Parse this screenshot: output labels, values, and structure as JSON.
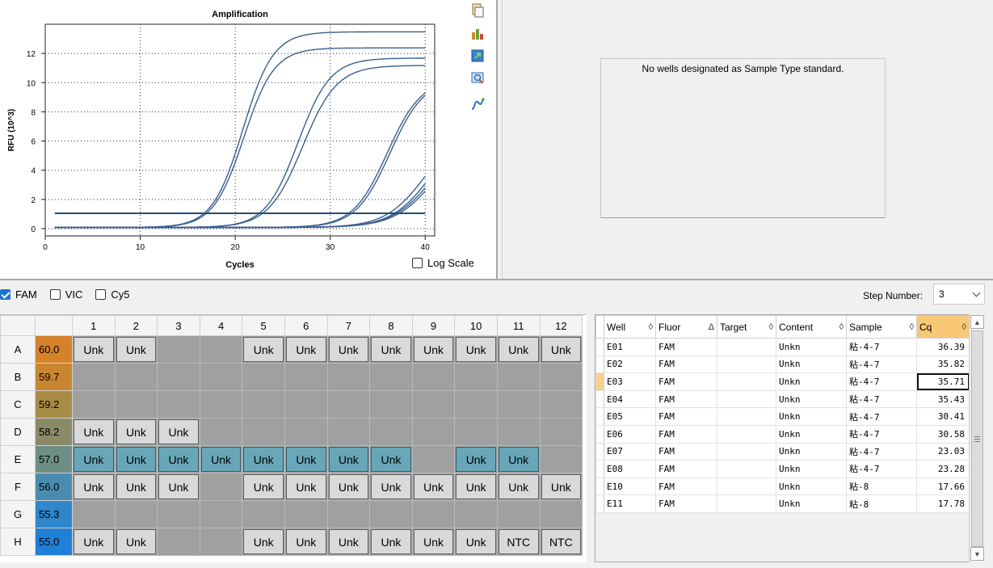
{
  "chart": {
    "title": "Amplification",
    "xlabel": "Cycles",
    "ylabel": "RFU (10^3)",
    "log_scale_label": "Log Scale"
  },
  "chart_data": {
    "type": "line",
    "title": "Amplification",
    "xlabel": "Cycles",
    "ylabel": "RFU (10^3)",
    "xlim": [
      0,
      41
    ],
    "ylim": [
      -0.5,
      14
    ],
    "xticks": [
      "0",
      "10",
      "20",
      "30",
      "40"
    ],
    "yticks": [
      "0",
      "2",
      "4",
      "6",
      "8",
      "10",
      "12"
    ],
    "grid": true,
    "threshold": 1.05,
    "curve_color": "#3a5f8f",
    "threshold_color": "#1f4e79",
    "curves": [
      {
        "well": "E07",
        "midpoint": 20.8,
        "max": 13.4,
        "slope": 1.6
      },
      {
        "well": "E08",
        "midpoint": 20.9,
        "max": 12.3,
        "slope": 1.6
      },
      {
        "well": "E05",
        "midpoint": 26.6,
        "max": 11.6,
        "slope": 1.7
      },
      {
        "well": "E06",
        "midpoint": 27.1,
        "max": 11.1,
        "slope": 1.8
      },
      {
        "well": "E10",
        "midpoint": 36.0,
        "max": 10.2,
        "slope": 1.8
      },
      {
        "well": "E11",
        "midpoint": 36.3,
        "max": 10.2,
        "slope": 1.8
      },
      {
        "well": "E01",
        "midpoint": 40.0,
        "max": 7.0,
        "slope": 2.1
      },
      {
        "well": "E02",
        "midpoint": 40.6,
        "max": 7.0,
        "slope": 2.1
      },
      {
        "well": "E03",
        "midpoint": 41.0,
        "max": 7.0,
        "slope": 2.2
      },
      {
        "well": "E04",
        "midpoint": 41.3,
        "max": 7.0,
        "slope": 2.2
      }
    ]
  },
  "std_panel": {
    "message": "No wells designated as Sample Type standard."
  },
  "fluors": [
    {
      "label": "FAM",
      "checked": true
    },
    {
      "label": "VIC",
      "checked": false
    },
    {
      "label": "Cy5",
      "checked": false
    }
  ],
  "step": {
    "label": "Step Number:",
    "value": "3"
  },
  "plate": {
    "columns": [
      "1",
      "2",
      "3",
      "4",
      "5",
      "6",
      "7",
      "8",
      "9",
      "10",
      "11",
      "12"
    ],
    "rows": [
      {
        "label": "A",
        "temp": "60.0",
        "temp_color": "#d6822a",
        "wells": [
          "Unk",
          "Unk",
          "",
          "",
          "Unk",
          "Unk",
          "Unk",
          "Unk",
          "Unk",
          "Unk",
          "Unk",
          "Unk"
        ],
        "selected": [
          false,
          false,
          false,
          false,
          false,
          false,
          false,
          false,
          false,
          false,
          false,
          false
        ]
      },
      {
        "label": "B",
        "temp": "59.7",
        "temp_color": "#c8862f",
        "wells": [
          "",
          "",
          "",
          "",
          "",
          "",
          "",
          "",
          "",
          "",
          "",
          ""
        ],
        "selected": [
          false,
          false,
          false,
          false,
          false,
          false,
          false,
          false,
          false,
          false,
          false,
          false
        ]
      },
      {
        "label": "C",
        "temp": "59.2",
        "temp_color": "#a88b45",
        "wells": [
          "",
          "",
          "",
          "",
          "",
          "",
          "",
          "",
          "",
          "",
          "",
          ""
        ],
        "selected": [
          false,
          false,
          false,
          false,
          false,
          false,
          false,
          false,
          false,
          false,
          false,
          false
        ]
      },
      {
        "label": "D",
        "temp": "58.2",
        "temp_color": "#8a8a68",
        "wells": [
          "Unk",
          "Unk",
          "Unk",
          "",
          "",
          "",
          "",
          "",
          "",
          "",
          "",
          ""
        ],
        "selected": [
          false,
          false,
          false,
          false,
          false,
          false,
          false,
          false,
          false,
          false,
          false,
          false
        ]
      },
      {
        "label": "E",
        "temp": "57.0",
        "temp_color": "#6d8f85",
        "wells": [
          "Unk",
          "Unk",
          "Unk",
          "Unk",
          "Unk",
          "Unk",
          "Unk",
          "Unk",
          "",
          "Unk",
          "Unk",
          ""
        ],
        "selected": [
          true,
          true,
          true,
          true,
          true,
          true,
          true,
          true,
          false,
          true,
          true,
          false
        ]
      },
      {
        "label": "F",
        "temp": "56.0",
        "temp_color": "#4a8bb0",
        "wells": [
          "Unk",
          "Unk",
          "Unk",
          "",
          "Unk",
          "Unk",
          "Unk",
          "Unk",
          "Unk",
          "Unk",
          "Unk",
          "Unk"
        ],
        "selected": [
          false,
          false,
          false,
          false,
          false,
          false,
          false,
          false,
          false,
          false,
          false,
          false
        ]
      },
      {
        "label": "G",
        "temp": "55.3",
        "temp_color": "#2f86c8",
        "wells": [
          "",
          "",
          "",
          "",
          "",
          "",
          "",
          "",
          "",
          "",
          "",
          ""
        ],
        "selected": [
          false,
          false,
          false,
          false,
          false,
          false,
          false,
          false,
          false,
          false,
          false,
          false
        ]
      },
      {
        "label": "H",
        "temp": "55.0",
        "temp_color": "#1f80d8",
        "wells": [
          "Unk",
          "Unk",
          "",
          "",
          "Unk",
          "Unk",
          "Unk",
          "Unk",
          "Unk",
          "Unk",
          "NTC",
          "NTC"
        ],
        "selected": [
          false,
          false,
          false,
          false,
          false,
          false,
          false,
          false,
          false,
          false,
          false,
          false
        ]
      }
    ]
  },
  "well_table": {
    "headers": {
      "well": "Well",
      "fluor": "Fluor",
      "target": "Target",
      "content": "Content",
      "sample": "Sample",
      "cq": "Cq"
    },
    "sort_icons": {
      "well": "◊",
      "fluor": "Δ",
      "target": "◊",
      "content": "◊",
      "sample": "◊",
      "cq": "◊"
    },
    "rows": [
      {
        "well": "E01",
        "fluor": "FAM",
        "target": "",
        "content": "Unkn",
        "sample": "粘-4-7",
        "cq": "36.39"
      },
      {
        "well": "E02",
        "fluor": "FAM",
        "target": "",
        "content": "Unkn",
        "sample": "粘-4-7",
        "cq": "35.82"
      },
      {
        "well": "E03",
        "fluor": "FAM",
        "target": "",
        "content": "Unkn",
        "sample": "粘-4-7",
        "cq": "35.71"
      },
      {
        "well": "E04",
        "fluor": "FAM",
        "target": "",
        "content": "Unkn",
        "sample": "粘-4-7",
        "cq": "35.43"
      },
      {
        "well": "E05",
        "fluor": "FAM",
        "target": "",
        "content": "Unkn",
        "sample": "粘-4-7",
        "cq": "30.41"
      },
      {
        "well": "E06",
        "fluor": "FAM",
        "target": "",
        "content": "Unkn",
        "sample": "粘-4-7",
        "cq": "30.58"
      },
      {
        "well": "E07",
        "fluor": "FAM",
        "target": "",
        "content": "Unkn",
        "sample": "粘-4-7",
        "cq": "23.03"
      },
      {
        "well": "E08",
        "fluor": "FAM",
        "target": "",
        "content": "Unkn",
        "sample": "粘-4-7",
        "cq": "23.28"
      },
      {
        "well": "E10",
        "fluor": "FAM",
        "target": "",
        "content": "Unkn",
        "sample": "粘-8",
        "cq": "17.66"
      },
      {
        "well": "E11",
        "fluor": "FAM",
        "target": "",
        "content": "Unkn",
        "sample": "粘-8",
        "cq": "17.78"
      }
    ],
    "active_row": 2
  },
  "toolbar_icons": [
    "copy-icon",
    "export-chart-icon",
    "export-data-icon",
    "zoom-icon",
    "curve-settings-icon"
  ]
}
